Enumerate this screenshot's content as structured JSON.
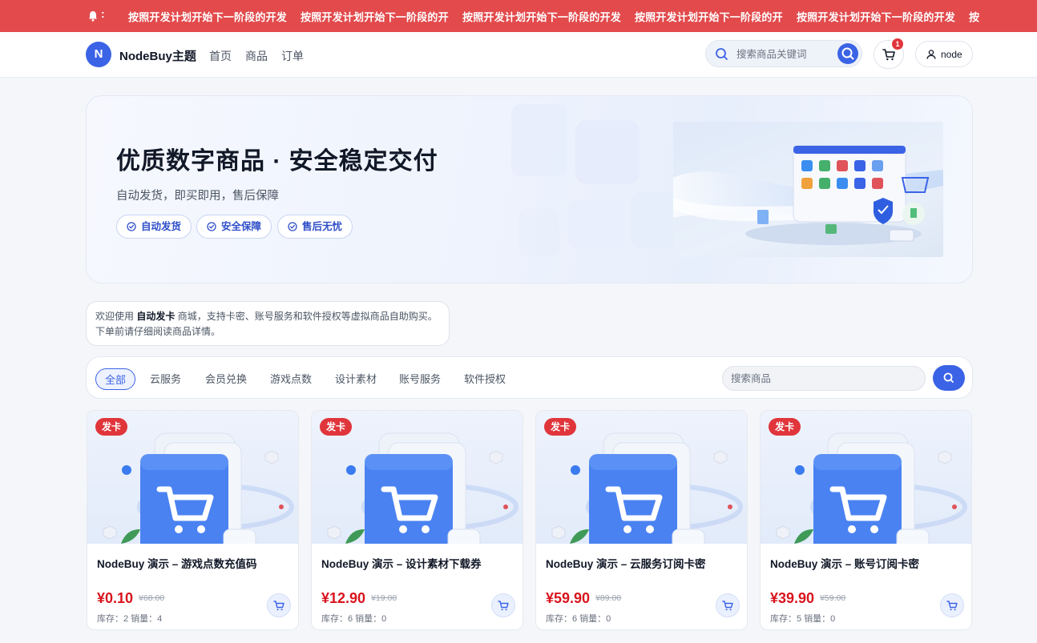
{
  "announcement": {
    "messages": [
      "按照开发计划开始下一阶段的开发",
      "按照开发计划开始下一阶段的开",
      "按照开发计划开始下一阶段的开发",
      "按照开发计划开始下一阶段的开",
      "按照开发计划开始下一阶段的开发",
      "按"
    ]
  },
  "header": {
    "logo_letter": "N",
    "brand": "NodeBuy主题",
    "nav": [
      "首页",
      "商品",
      "订单"
    ],
    "search_placeholder": "搜索商品关键词",
    "cart_count": "1",
    "user_name": "node"
  },
  "hero": {
    "title": "优质数字商品 · 安全稳定交付",
    "subtitle": "自动发货，即买即用，售后保障",
    "features": [
      "自动发货",
      "安全保障",
      "售后无忧"
    ]
  },
  "notice": {
    "prefix": "欢迎使用 ",
    "highlight": "自动发卡",
    "suffix": " 商城，支持卡密、账号服务和软件授权等虚拟商品自助购买。",
    "line2": "下单前请仔细阅读商品详情。"
  },
  "filter": {
    "categories": [
      "全部",
      "云服务",
      "会员兑换",
      "游戏点数",
      "设计素材",
      "账号服务",
      "软件授权"
    ],
    "active": "全部",
    "search_placeholder": "搜索商品"
  },
  "products": [
    {
      "tag": "发卡",
      "title": "NodeBuy 演示 – 游戏点数充值码",
      "price": "¥0.10",
      "orig": "¥68.00",
      "meta": "库存：2   销量：4"
    },
    {
      "tag": "发卡",
      "title": "NodeBuy 演示 – 设计素材下载券",
      "price": "¥12.90",
      "orig": "¥19.00",
      "meta": "库存：6   销量：0"
    },
    {
      "tag": "发卡",
      "title": "NodeBuy 演示 – 云服务订阅卡密",
      "price": "¥59.90",
      "orig": "¥89.00",
      "meta": "库存：6   销量：0"
    },
    {
      "tag": "发卡",
      "title": "NodeBuy 演示 – 账号订阅卡密",
      "price": "¥39.90",
      "orig": "¥59.00",
      "meta": "库存：5   销量：0"
    }
  ],
  "colors": {
    "accent": "#3b63e6",
    "announcement_bg": "#e24a4c",
    "price": "#d8141d",
    "tag": "#e0353b"
  }
}
